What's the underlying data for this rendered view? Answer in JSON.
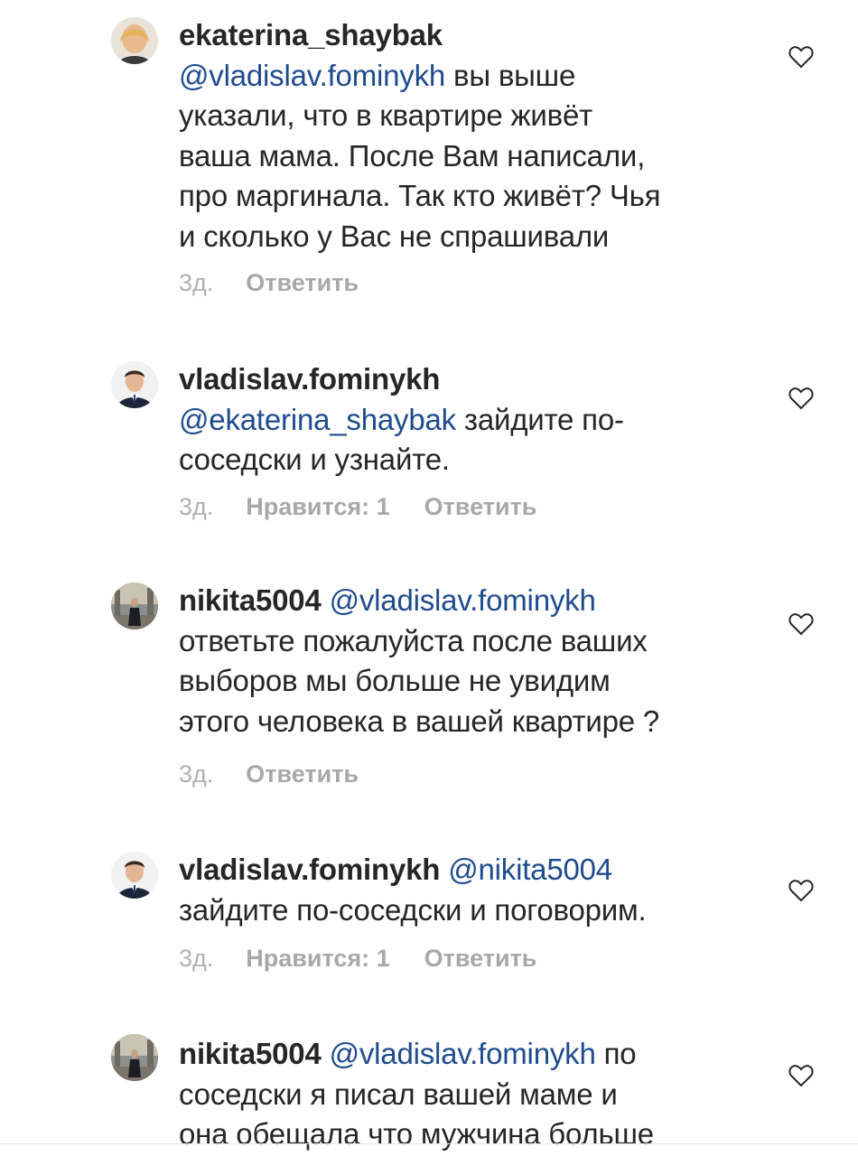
{
  "comments": [
    {
      "username": "ekaterina_shaybak",
      "mention": "",
      "text_lines": [
        "",
        "указали, что в квартире живёт",
        "ваша мама. После Вам написали,",
        "про маргинала. Так кто живёт? Чья",
        "и сколько у Вас не спрашивали"
      ],
      "line1_mention": "@vladislav.fominykh",
      "line1_text": " вы выше",
      "time": "3д.",
      "likes": "",
      "reply": "Ответить"
    },
    {
      "username": "vladislav.fominykh",
      "line1_mention": "@ekaterina_shaybak",
      "line1_text": " зайдите по-",
      "text_lines": [
        "соседски и узнайте."
      ],
      "time": "3д.",
      "likes": "Нравится: 1",
      "reply": "Ответить"
    },
    {
      "username": "nikita5004",
      "inline_mention": "@vladislav.fominykh",
      "text_lines": [
        "ответьте пожалуйста после ваших",
        "выборов мы больше не увидим",
        "этого человека в вашей квартире ?"
      ],
      "time": "3д.",
      "likes": "",
      "reply": "Ответить"
    },
    {
      "username": "vladislav.fominykh",
      "inline_mention": "@nikita5004",
      "text_lines": [
        "зайдите по-соседски и поговорим."
      ],
      "time": "3д.",
      "likes": "Нравится: 1",
      "reply": "Ответить"
    },
    {
      "username": "nikita5004",
      "inline_mention": "@vladislav.fominykh",
      "inline_text": " по",
      "text_lines": [
        "соседски я писал вашей маме и",
        "она обещала что мужчина больше"
      ]
    }
  ],
  "colors": {
    "mention": "#1f4b8e",
    "text": "#262626",
    "meta": "#a8a8a8"
  },
  "icons": {
    "like": "heart-outline-icon"
  }
}
